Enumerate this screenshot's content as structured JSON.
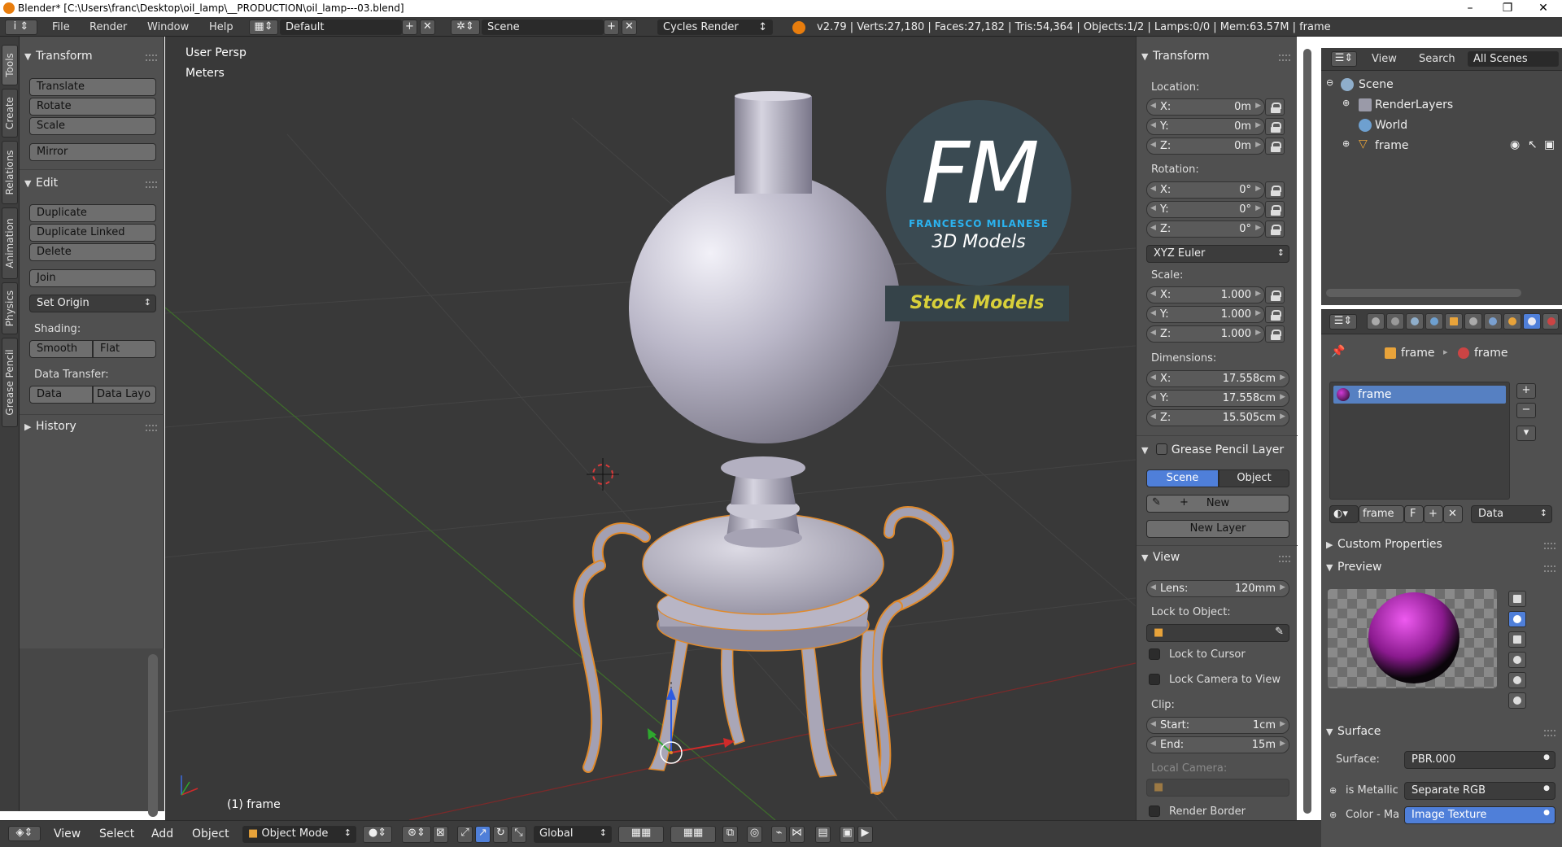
{
  "window": {
    "title": "Blender* [C:\\Users\\franc\\Desktop\\oil_lamp\\__PRODUCTION\\oil_lamp---03.blend]",
    "minimize_glyph": "–",
    "maximize_glyph": "❐",
    "close_glyph": "✕"
  },
  "topbar": {
    "menus": [
      "File",
      "Render",
      "Window",
      "Help"
    ],
    "layout": "Default",
    "scene": "Scene",
    "engine": "Cycles Render",
    "stats": "v2.79 | Verts:27,180 | Faces:27,182 | Tris:54,364 | Objects:1/2 | Lamps:0/0 | Mem:63.57M | frame",
    "plus_glyph": "+",
    "close_glyph": "✕",
    "updown_glyph": "↕"
  },
  "tabs": [
    "Tools",
    "Create",
    "Relations",
    "Animation",
    "Physics",
    "Grease Pencil"
  ],
  "toolshelf": {
    "transform_header": "Transform",
    "translate": "Translate",
    "rotate": "Rotate",
    "scale": "Scale",
    "mirror": "Mirror",
    "edit_header": "Edit",
    "duplicate": "Duplicate",
    "duplicate_linked": "Duplicate Linked",
    "delete": "Delete",
    "join": "Join",
    "set_origin": "Set Origin",
    "shading_label": "Shading:",
    "smooth": "Smooth",
    "flat": "Flat",
    "data_transfer_label": "Data Transfer:",
    "data": "Data",
    "data_layout": "Data Layo",
    "history_header": "History",
    "arrow_open": "▼",
    "arrow_closed": "▶"
  },
  "viewport": {
    "view_name": "User Persp",
    "units": "Meters",
    "object_label": "(1) frame",
    "logo": {
      "letters": "FM",
      "author": "FRANCESCO MILANESE",
      "subtitle": "3D Models",
      "banner": "Stock Models"
    },
    "colors": {
      "background": "#393939",
      "lamp": "#b9b6c8",
      "logo_disc": "#3a4a52",
      "logo_accent": "#2bb3f0",
      "banner_text": "#d8d03a"
    }
  },
  "npanel": {
    "transform_header": "Transform",
    "location_label": "Location:",
    "location": [
      {
        "axis": "X:",
        "value": "0m"
      },
      {
        "axis": "Y:",
        "value": "0m"
      },
      {
        "axis": "Z:",
        "value": "0m"
      }
    ],
    "rotation_label": "Rotation:",
    "rotation": [
      {
        "axis": "X:",
        "value": "0°"
      },
      {
        "axis": "Y:",
        "value": "0°"
      },
      {
        "axis": "Z:",
        "value": "0°"
      }
    ],
    "rotation_mode": "XYZ Euler",
    "scale_label": "Scale:",
    "scale": [
      {
        "axis": "X:",
        "value": "1.000"
      },
      {
        "axis": "Y:",
        "value": "1.000"
      },
      {
        "axis": "Z:",
        "value": "1.000"
      }
    ],
    "dimensions_label": "Dimensions:",
    "dimensions": [
      {
        "axis": "X:",
        "value": "17.558cm"
      },
      {
        "axis": "Y:",
        "value": "17.558cm"
      },
      {
        "axis": "Z:",
        "value": "15.505cm"
      }
    ],
    "grease_header": "Grease Pencil Layer",
    "scene_tab": "Scene",
    "object_tab": "Object",
    "new": "New",
    "new_layer": "New Layer",
    "view_header": "View",
    "lens_key": "Lens:",
    "lens_value": "120mm",
    "lock_to_object": "Lock to Object:",
    "lock_cursor": "Lock to Cursor",
    "lock_camera": "Lock Camera to View",
    "clip_label": "Clip:",
    "clip_start_key": "Start:",
    "clip_start_value": "1cm",
    "clip_end_key": "End:",
    "clip_end_value": "15m",
    "local_camera": "Local Camera:",
    "render_border": "Render Border",
    "left_arrow": "◀",
    "right_arrow": "▶"
  },
  "outliner": {
    "view": "View",
    "search": "Search",
    "filter": "All Scenes",
    "items": [
      "Scene",
      "RenderLayers",
      "World",
      "frame"
    ]
  },
  "properties": {
    "object_name": "frame",
    "material_name": "frame",
    "slot_name": "frame",
    "material_field": "frame",
    "fake_user": "F",
    "link": "Data",
    "custom_props": "Custom Properties",
    "preview": "Preview",
    "surface_header": "Surface",
    "surface_label": "Surface:",
    "surface_value": "PBR.000",
    "metallic_label": "is Metallic",
    "metallic_value": "Separate RGB",
    "color_label": "Color - Ma",
    "color_value": "Image Texture"
  },
  "bottombar": {
    "menus": [
      "View",
      "Select",
      "Add",
      "Object"
    ],
    "mode": "Object Mode",
    "orientation": "Global"
  }
}
